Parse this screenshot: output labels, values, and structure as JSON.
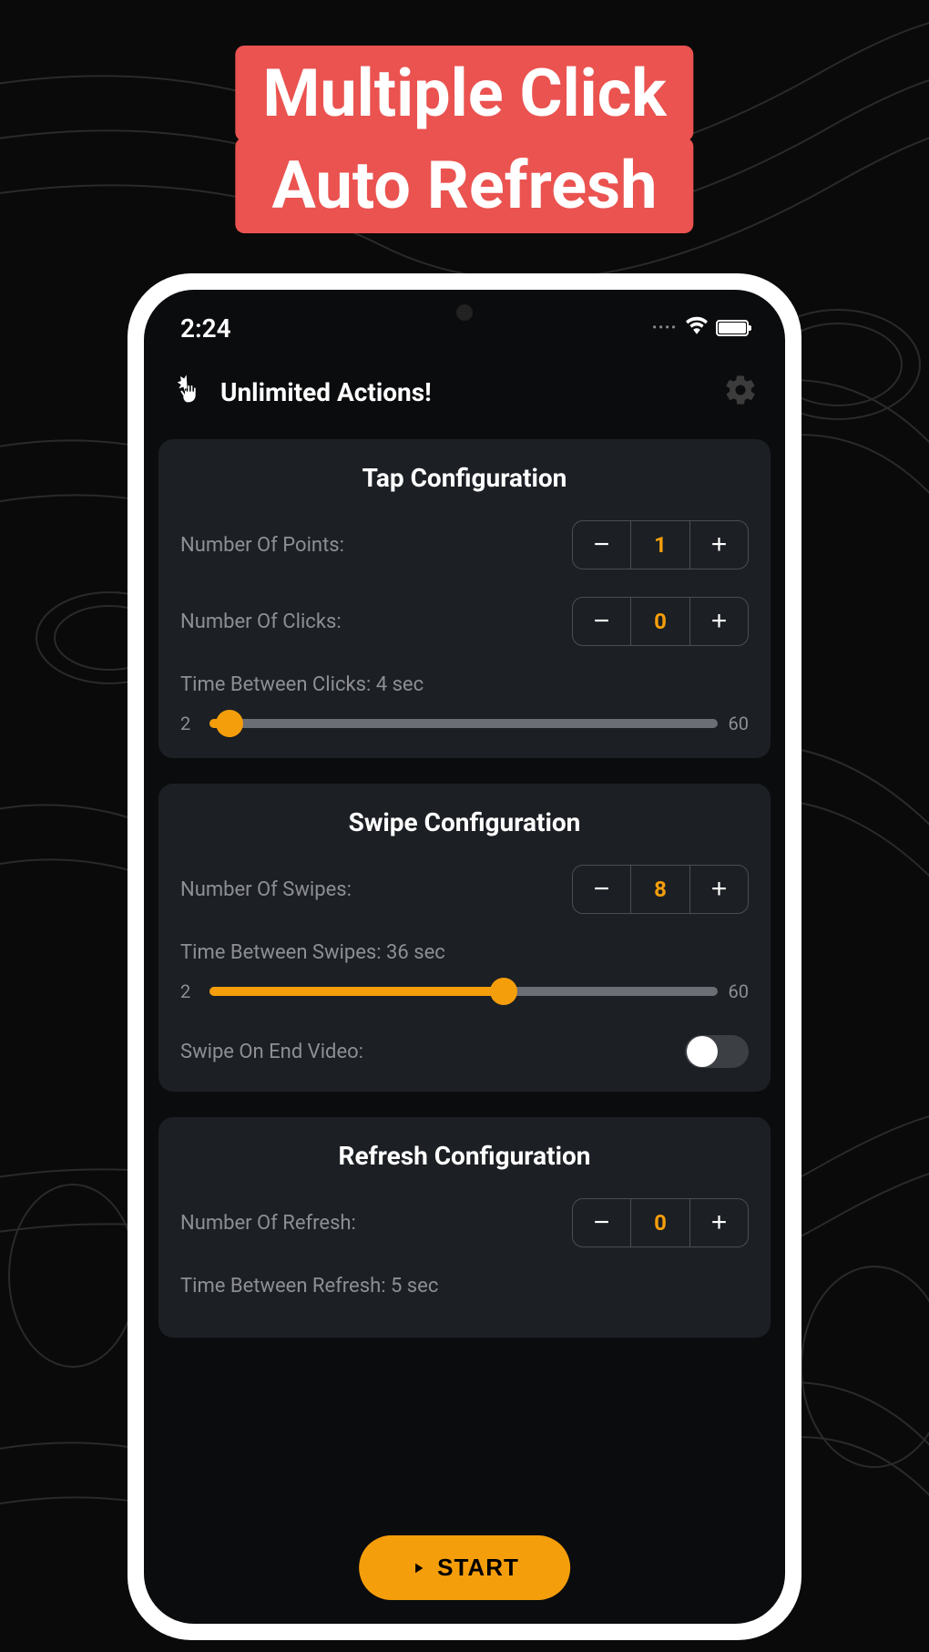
{
  "banner": {
    "line1": "Multiple Click",
    "line2": "Auto Refresh"
  },
  "status": {
    "time": "2:24"
  },
  "header": {
    "title": "Unlimited Actions!"
  },
  "tap": {
    "title": "Tap Configuration",
    "points_label": "Number Of Points:",
    "points_value": "1",
    "clicks_label": "Number Of Clicks:",
    "clicks_value": "0",
    "slider_label": "Time Between Clicks: 4 sec",
    "slider_min": "2",
    "slider_max": "60",
    "slider_fill_pct": "4",
    "slider_thumb_pct": "4"
  },
  "swipe": {
    "title": "Swipe Configuration",
    "swipes_label": "Number Of Swipes:",
    "swipes_value": "8",
    "slider_label": "Time Between Swipes: 36 sec",
    "slider_min": "2",
    "slider_max": "60",
    "slider_fill_pct": "58",
    "slider_thumb_pct": "58",
    "toggle_label": "Swipe On End Video:"
  },
  "refresh": {
    "title": "Refresh Configuration",
    "refresh_label": "Number Of Refresh:",
    "refresh_value": "0",
    "slider_label": "Time Between Refresh: 5 sec"
  },
  "start_label": "START",
  "minus": "−",
  "plus": "+"
}
